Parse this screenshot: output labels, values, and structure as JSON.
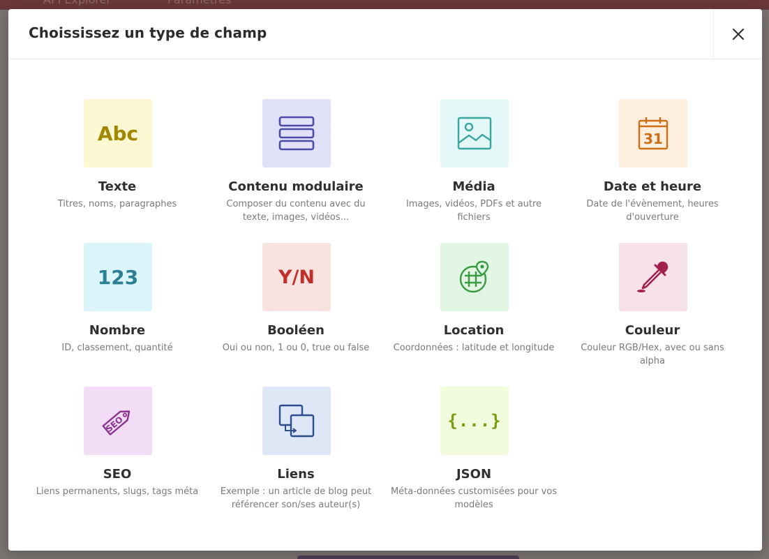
{
  "background": {
    "tabs": [
      "API Explorer",
      "Paramètres"
    ]
  },
  "modal": {
    "title": "Choississez un type de champ",
    "close_icon": "close-icon"
  },
  "field_types": [
    {
      "title": "Texte",
      "desc": "Titres, noms, paragraphes",
      "glyph": "Abc",
      "icon": "text-icon",
      "bg": "#fdf7d3",
      "color": "#a08800"
    },
    {
      "title": "Contenu modulaire",
      "desc": "Composer du contenu avec du texte, images, vidéos...",
      "icon": "modular-content-icon",
      "bg": "#e1e1f7",
      "color": "#4a4aa8"
    },
    {
      "title": "Média",
      "desc": "Images, vidéos, PDFs et autre fichiers",
      "icon": "media-image-icon",
      "bg": "#e2f7f6",
      "color": "#3aa6a0"
    },
    {
      "title": "Date et heure",
      "desc": "Date de l'évènement, heures d'ouverture",
      "glyph": "31",
      "icon": "calendar-icon",
      "bg": "#fdeedd",
      "color": "#cc6e16"
    },
    {
      "title": "Nombre",
      "desc": "ID, classement, quantité",
      "glyph": "123",
      "icon": "number-icon",
      "bg": "#dcf5fa",
      "color": "#2c7f94"
    },
    {
      "title": "Booléen",
      "desc": "Oui ou non, 1 ou 0, true ou false",
      "glyph": "Y/N",
      "icon": "boolean-icon",
      "bg": "#f9e3e1",
      "color": "#c0302a"
    },
    {
      "title": "Location",
      "desc": "Coordonnées : latitude et longitude",
      "icon": "location-globe-icon",
      "bg": "#e1f7e3",
      "color": "#3a9a44"
    },
    {
      "title": "Couleur",
      "desc": "Couleur RGB/Hex, avec ou sans alpha",
      "icon": "color-dropper-icon",
      "bg": "#f8e2ea",
      "color": "#a3204d"
    },
    {
      "title": "SEO",
      "desc": "Liens permanents, slugs, tags méta",
      "glyph": "SEO",
      "icon": "seo-tag-icon",
      "bg": "#f2dcf6",
      "color": "#8a3390"
    },
    {
      "title": "Liens",
      "desc": "Exemple : un article de blog peut référencer son/ses auteur(s)",
      "icon": "links-icon",
      "bg": "#dde7f6",
      "color": "#2c4c8a"
    },
    {
      "title": "JSON",
      "desc": "Méta-données customisées pour vos modèles",
      "glyph": "{...}",
      "icon": "json-icon",
      "bg": "#f2fbdc",
      "color": "#7a9a10"
    }
  ]
}
